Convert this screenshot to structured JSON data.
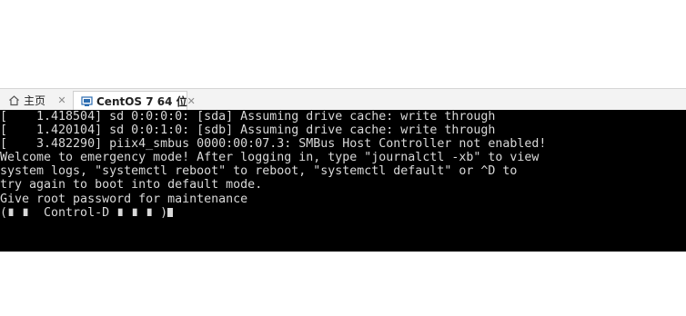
{
  "tabs": [
    {
      "label": "主页",
      "icon": "home-icon"
    },
    {
      "label": "CentOS 7 64 位",
      "icon": "vm-console-icon"
    }
  ],
  "console": {
    "lines": [
      "[    1.418504] sd 0:0:0:0: [sda] Assuming drive cache: write through",
      "[    1.420104] sd 0:0:1:0: [sdb] Assuming drive cache: write through",
      "[    3.482290] piix4_smbus 0000:00:07.3: SMBus Host Controller not enabled!",
      "Welcome to emergency mode! After logging in, type \"journalctl -xb\" to view",
      "system logs, \"systemctl reboot\" to reboot, \"systemctl default\" or ^D to",
      "try again to boot into default mode.",
      "Give root password for maintenance",
      "(∎ ∎  Control-D ∎ ∎ ∎ )"
    ]
  },
  "colors": {
    "console_bg": "#000000",
    "console_fg": "#d9d9d9",
    "tabbar_bg": "#f3f3f3"
  }
}
